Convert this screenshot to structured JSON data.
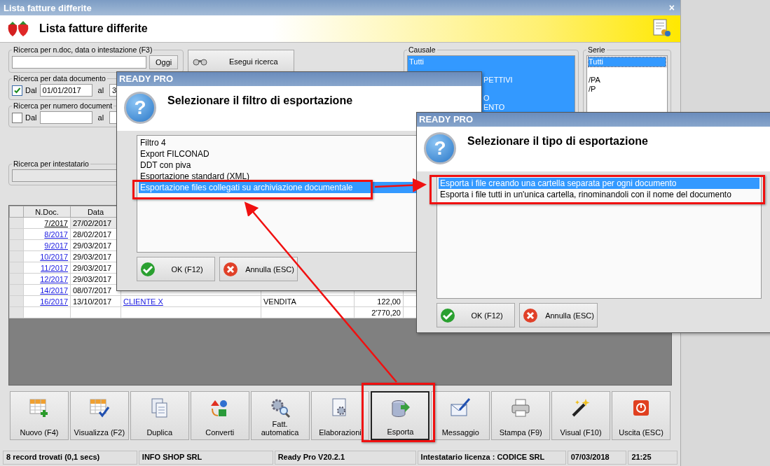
{
  "window": {
    "title": "Lista fatture differite",
    "close": "×",
    "heading": "Lista fatture differite"
  },
  "search": {
    "group": "Ricerca per n.doc, data o intestazione (F3)",
    "today_button": "Oggi",
    "run_button": "Esegui ricerca"
  },
  "date_filter": {
    "group": "Ricerca per data documento",
    "checked": true,
    "from_label": "Dal",
    "from": "01/01/2017",
    "to_label": "al",
    "to": "3"
  },
  "number_filter": {
    "group": "Ricerca per numero document",
    "checked": false,
    "from_label": "Dal",
    "to_label": "al"
  },
  "holder_filter": {
    "group": "Ricerca per intestatario"
  },
  "causale": {
    "group": "Causale",
    "items": [
      {
        "text": "Tutti",
        "kind": "full"
      },
      {
        "kind": "blank"
      },
      {
        "text": "PETTIVI",
        "kind": "cut"
      },
      {
        "kind": "blank"
      },
      {
        "text": "O",
        "kind": "cut"
      },
      {
        "text": "ENTO",
        "kind": "cut"
      }
    ]
  },
  "serie": {
    "group": "Serie",
    "items": [
      {
        "text": "Tutti",
        "selected": true
      },
      {
        "text": "/PA",
        "selected": false
      },
      {
        "text": "/P",
        "selected": false
      }
    ]
  },
  "table": {
    "columns": [
      "N.Doc.",
      "Data"
    ],
    "rows": [
      {
        "doc": "7/2017",
        "date": "27/02/2017",
        "selected": true
      },
      {
        "doc": "8/2017",
        "date": "28/02/2017",
        "selected": false
      },
      {
        "doc": "9/2017",
        "date": "29/03/2017",
        "selected": false
      },
      {
        "doc": "10/2017",
        "date": "29/03/2017",
        "selected": false
      },
      {
        "doc": "11/2017",
        "date": "29/03/2017",
        "selected": false
      },
      {
        "doc": "12/2017",
        "date": "29/03/2017",
        "selected": false
      },
      {
        "doc": "14/2017",
        "date": "08/07/2017",
        "selected": false
      },
      {
        "doc": "16/2017",
        "date": "13/10/2017",
        "selected": false,
        "customer": "CLIENTE X",
        "causale": "VENDITA",
        "amount": "122,00"
      }
    ],
    "total": "2'770,20"
  },
  "toolbar": [
    {
      "label": "Nuovo (F4)",
      "kind": "new",
      "selected": false
    },
    {
      "label": "Visualizza (F2)",
      "kind": "view",
      "selected": false
    },
    {
      "label": "Duplica",
      "kind": "copy",
      "selected": false
    },
    {
      "label": "Converti",
      "kind": "convert",
      "selected": false
    },
    {
      "label": "Fatt. automatica",
      "kind": "auto",
      "selected": false
    },
    {
      "label": "Elaborazioni",
      "kind": "process",
      "selected": false
    },
    {
      "label": "Esporta",
      "kind": "export",
      "selected": true
    },
    {
      "label": "Messaggio",
      "kind": "mail",
      "selected": false
    },
    {
      "label": "Stampa (F9)",
      "kind": "print",
      "selected": false
    },
    {
      "label": "Visual (F10)",
      "kind": "wand",
      "selected": false
    },
    {
      "label": "Uscita (ESC)",
      "kind": "exit",
      "selected": false
    }
  ],
  "status_bar": [
    "8 record trovati (0,1 secs)",
    "INFO SHOP SRL",
    "Ready Pro V20.2.1",
    "Intestatario licenza : CODICE SRL",
    "07/03/2018",
    "21:25"
  ],
  "dialogs": [
    {
      "title": "READY PRO",
      "icon": "?",
      "heading": "Selezionare il filtro di esportazione",
      "items": [
        {
          "text": "Filtro 4",
          "selected": false
        },
        {
          "text": "Export FILCONAD",
          "selected": false
        },
        {
          "text": "DDT con piva",
          "selected": false
        },
        {
          "text": "Esportazione standard (XML)",
          "selected": false
        },
        {
          "text": "Esportazione files collegati su archiviazione documentale",
          "selected": true
        }
      ],
      "ok": "OK (F12)",
      "cancel": "Annulla (ESC)"
    },
    {
      "title": "READY PRO",
      "icon": "?",
      "heading": "Selezionare il tipo di esportazione",
      "items": [
        {
          "text": "Esporta i file creando una cartella separata per ogni documento",
          "selected": true
        },
        {
          "text": "Esporta i file tutti in un'unica cartella, rinominandoli con il nome del documento",
          "selected": false
        }
      ],
      "ok": "OK (F12)",
      "cancel": "Annulla (ESC)"
    }
  ]
}
